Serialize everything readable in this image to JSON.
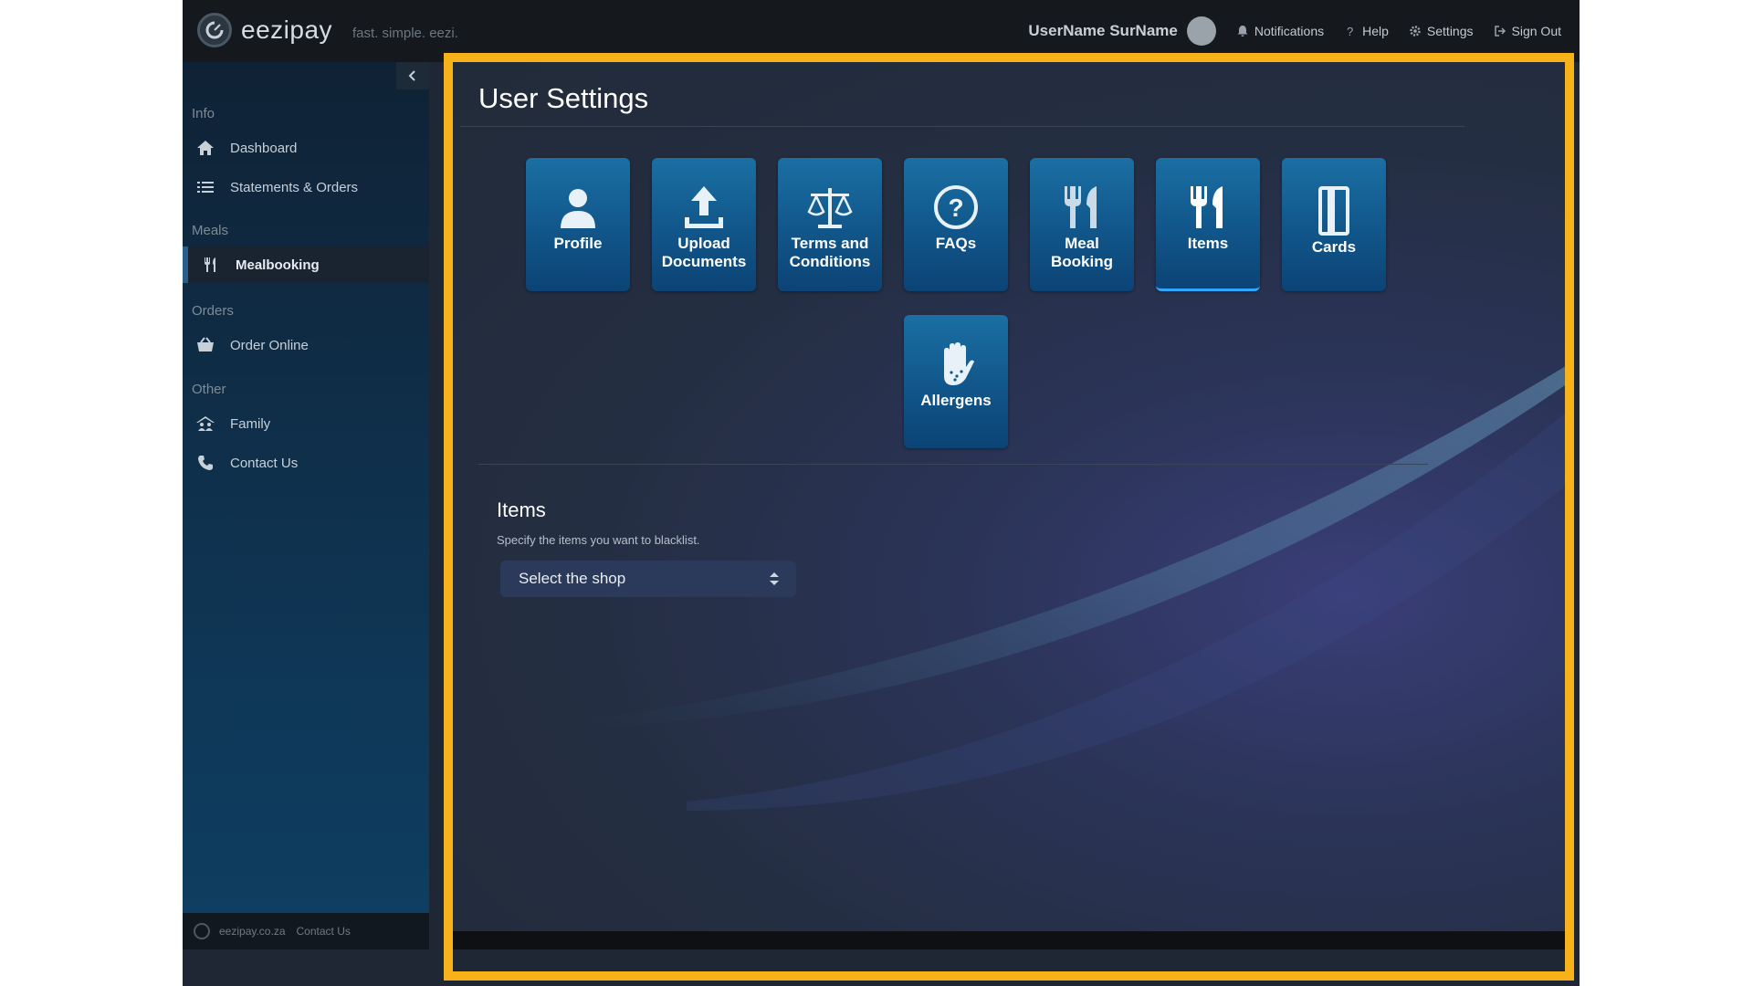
{
  "brand": {
    "name": "eezipay",
    "tagline": "fast. simple. eezi."
  },
  "header": {
    "user_name": "UserName SurName",
    "links": [
      {
        "label": "Notifications",
        "icon": "bell-icon"
      },
      {
        "label": "Help",
        "icon": "help-icon"
      },
      {
        "label": "Settings",
        "icon": "gear-icon"
      },
      {
        "label": "Sign Out",
        "icon": "sign-out-icon"
      }
    ]
  },
  "sidebar": {
    "sections": [
      "Info",
      "Meals",
      "Orders",
      "Other"
    ],
    "items": [
      {
        "label": "Dashboard",
        "icon": "home-icon"
      },
      {
        "label": "Statements & Orders",
        "icon": "list-icon"
      },
      {
        "label": "Mealbooking",
        "icon": "cutlery-icon"
      },
      {
        "label": "Order Online",
        "icon": "basket-icon"
      },
      {
        "label": "Family",
        "icon": "family-icon"
      },
      {
        "label": "Contact Us",
        "icon": "phone-icon"
      }
    ],
    "footer": {
      "site": "eezipay.co.za",
      "contact": "Contact Us"
    }
  },
  "main": {
    "title": "User Settings",
    "tiles": [
      {
        "label": "Profile",
        "icon": "user-icon"
      },
      {
        "label": "Upload Documents",
        "icon": "upload-icon"
      },
      {
        "label": "Terms and Conditions",
        "icon": "scale-icon"
      },
      {
        "label": "FAQs",
        "icon": "question-icon"
      },
      {
        "label": "Meal Booking",
        "icon": "cutlery-icon"
      },
      {
        "label": "Items",
        "icon": "cutlery-icon"
      },
      {
        "label": "Cards",
        "icon": "card-icon"
      },
      {
        "label": "Allergens",
        "icon": "hand-icon"
      }
    ],
    "items_section": {
      "heading": "Items",
      "description": "Specify the items you want to blacklist.",
      "select_value": "Select the shop"
    }
  },
  "colors": {
    "highlight": "#f7b21a",
    "tile": "#11568a",
    "tile_selected_accent": "#2ea8ff",
    "sidebar": "#0f3452",
    "topbar": "#15181d"
  }
}
